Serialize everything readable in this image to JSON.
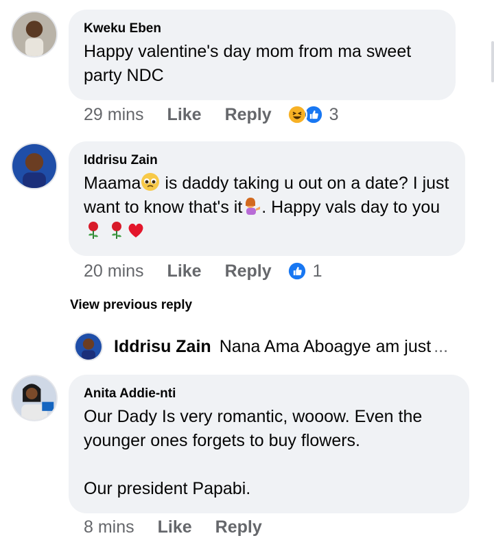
{
  "comments": [
    {
      "author": "Kweku Eben",
      "text_lines": [
        "Happy valentine's day  mom from ma sweet party NDC"
      ],
      "time": "29 mins",
      "like_label": "Like",
      "reply_label": "Reply",
      "reaction_icons": [
        "laughing-face-icon",
        "thumbs-up-icon"
      ],
      "reaction_count": "3"
    },
    {
      "author": "Iddrisu Zain",
      "text_part1": "Maama",
      "text_part2": " is daddy taking u out on a date? I just want to know that's it",
      "text_part3": ". Happy vals day to you",
      "inline_emojis": [
        "pleading-face-icon",
        "woman-tipping-hand-icon",
        "rose-icon",
        "rose-icon",
        "red-heart-icon"
      ],
      "time": "20 mins",
      "like_label": "Like",
      "reply_label": "Reply",
      "reaction_icons": [
        "thumbs-up-icon"
      ],
      "reaction_count": "1"
    },
    {
      "author": "Anita Addie-nti",
      "text_para1": "Our Dady Is very  romantic,  wooow.  Even the younger ones forgets to buy flowers.",
      "text_para2": "Our president Papabi.",
      "time": "8 mins",
      "like_label": "Like",
      "reply_label": "Reply"
    }
  ],
  "view_previous_reply": "View previous reply",
  "reply_preview": {
    "author": "Iddrisu Zain",
    "text": "Nana Ama Aboagye am just",
    "ellipsis": "..."
  },
  "colors": {
    "bubble": "#f0f2f5",
    "meta_text": "#65676b",
    "like_blue": "#1877f2",
    "haha_yellow": "#f7b125"
  }
}
